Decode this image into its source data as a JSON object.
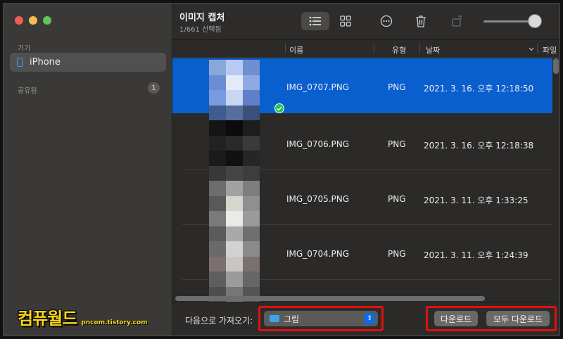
{
  "window": {
    "title": "이미지 캡처",
    "subtitle": "1/661 선택됨"
  },
  "sidebar": {
    "devices_label": "기기",
    "device_name": "iPhone",
    "shared_label": "공유됨",
    "shared_count": "1"
  },
  "columns": {
    "name": "이름",
    "type": "유형",
    "date": "날짜",
    "size": "파일"
  },
  "rows": [
    {
      "name": "IMG_0707.PNG",
      "type": "PNG",
      "date": "2021. 3. 16. 오후 12:18:50",
      "selected": true
    },
    {
      "name": "IMG_0706.PNG",
      "type": "PNG",
      "date": "2021. 3. 16. 오후 12:18:38",
      "selected": false
    },
    {
      "name": "IMG_0705.PNG",
      "type": "PNG",
      "date": "2021. 3. 11. 오후 1:33:25",
      "selected": false
    },
    {
      "name": "IMG_0704.PNG",
      "type": "PNG",
      "date": "2021. 3. 11. 오후 1:24:39",
      "selected": false
    }
  ],
  "footer": {
    "import_label": "다음으로 가져오기:",
    "import_destination": "그림",
    "download_label": "다운로드",
    "download_all_label": "모두 다운로드"
  },
  "watermark": {
    "main": "컴퓨월드",
    "sub": "pncom.tistory.com"
  },
  "colors": {
    "selection": "#0a5fcf",
    "highlight": "#e11010",
    "accent": "#0f6be3"
  }
}
